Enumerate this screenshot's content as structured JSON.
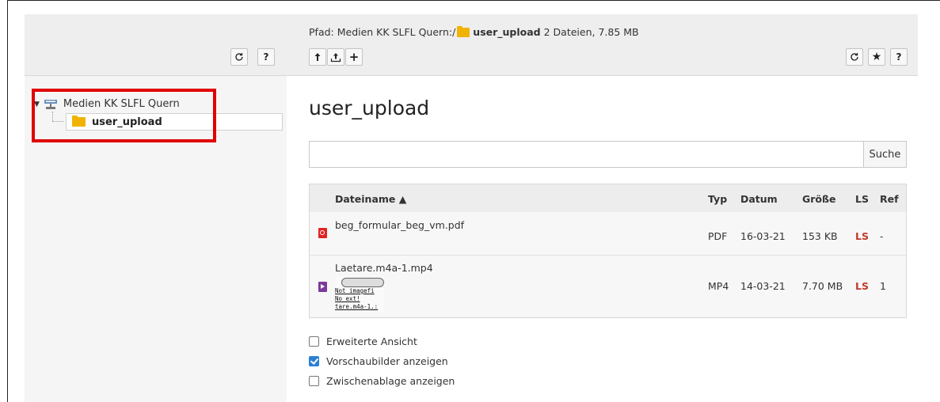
{
  "tree_header": {
    "reload_icon": "reload-icon",
    "help_label": "?"
  },
  "path_bar": {
    "prefix": "Pfad: Medien KK SLFL Quern:/",
    "folder": "user_upload",
    "summary": "2 Dateien, 7.85 MB"
  },
  "toolbar": {
    "up_icon": "folder-up-icon",
    "upload_icon": "upload-icon",
    "add_label": "+",
    "star_label": "★",
    "help_label": "?"
  },
  "tree": {
    "root_label": "Medien KK SLFL Quern",
    "selected_label": "user_upload"
  },
  "main": {
    "title": "user_upload",
    "search_placeholder": "",
    "search_button": "Suche"
  },
  "table": {
    "headers": {
      "name": "Dateiname ▲",
      "type": "Typ",
      "date": "Datum",
      "size": "Größe",
      "ls": "LS",
      "ref": "Ref"
    },
    "rows": [
      {
        "name": "beg_formular_beg_vm.pdf",
        "type": "PDF",
        "date": "16-03-21",
        "size": "153 KB",
        "ls": "LS",
        "ref": "-",
        "icon": "pdf-icon"
      },
      {
        "name": "Laetare.m4a-1.mp4",
        "type": "MP4",
        "date": "14-03-21",
        "size": "7.70 MB",
        "ls": "LS",
        "ref": "1",
        "icon": "video-icon",
        "thumbnail_lines": [
          "Not imagefi",
          "No ext!",
          "tare.m4a-1.:"
        ]
      }
    ]
  },
  "options": [
    {
      "label": "Erweiterte Ansicht",
      "checked": false
    },
    {
      "label": "Vorschaubilder anzeigen",
      "checked": true
    },
    {
      "label": "Zwischenablage anzeigen",
      "checked": false
    }
  ],
  "colors": {
    "highlight_box": "#e00000",
    "ls_red": "#c0392b",
    "folder_yellow": "#f0b400",
    "checkbox_blue": "#2b7fd4"
  }
}
